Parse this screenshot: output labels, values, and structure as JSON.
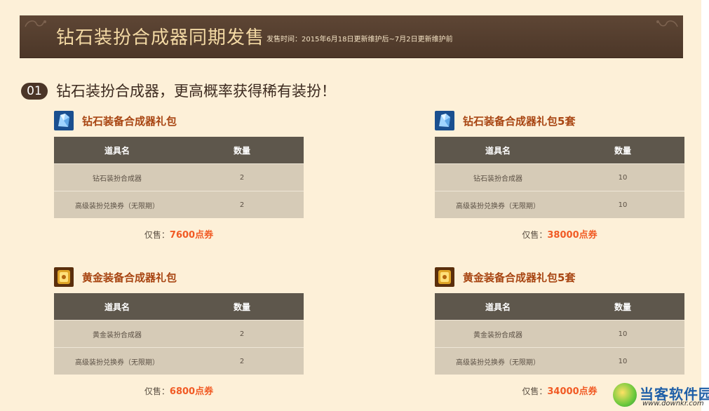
{
  "banner": {
    "title": "钻石装扮合成器同期发售",
    "sale_time": "发售时间：2015年6月18日更新维护后~7月2日更新维护前"
  },
  "section": {
    "number": "01",
    "title": "钻石装扮合成器，更高概率获得稀有装扮！"
  },
  "packs": [
    {
      "name": "钻石装备合成器礼包",
      "icon": "diamond-synthesizer-icon",
      "headers": [
        "道具名",
        "数量"
      ],
      "rows": [
        [
          "钻石装扮合成器",
          "2"
        ],
        [
          "高级装扮兑换券（无限期）",
          "2"
        ]
      ],
      "price_label": "仅售：",
      "price_value": "7600点券"
    },
    {
      "name": "钻石装备合成器礼包5套",
      "icon": "diamond-synthesizer-icon",
      "headers": [
        "道具名",
        "数量"
      ],
      "rows": [
        [
          "钻石装扮合成器",
          "10"
        ],
        [
          "高级装扮兑换券（无限期）",
          "10"
        ]
      ],
      "price_label": "仅售：",
      "price_value": "38000点券"
    },
    {
      "name": "黄金装备合成器礼包",
      "icon": "gold-synthesizer-icon",
      "headers": [
        "道具名",
        "数量"
      ],
      "rows": [
        [
          "黄金装扮合成器",
          "2"
        ],
        [
          "高级装扮兑换券（无限期）",
          "2"
        ]
      ],
      "price_label": "仅售：",
      "price_value": "6800点券"
    },
    {
      "name": "黄金装备合成器礼包5套",
      "icon": "gold-synthesizer-icon",
      "headers": [
        "道具名",
        "数量"
      ],
      "rows": [
        [
          "黄金装扮合成器",
          "10"
        ],
        [
          "高级装扮兑换券（无限期）",
          "10"
        ]
      ],
      "price_label": "仅售：",
      "price_value": "34000点券"
    }
  ],
  "watermark": {
    "name": "当客软件园",
    "url": "www.downkr.com"
  },
  "colors": {
    "page_bg": "#fdf0d8",
    "banner_bg": "#4c3728",
    "banner_title": "#f3d9a4",
    "pack_name": "#a84512",
    "table_header": "#5e574c",
    "table_cell": "#d6cbb7",
    "price_accent": "#f15a24"
  }
}
